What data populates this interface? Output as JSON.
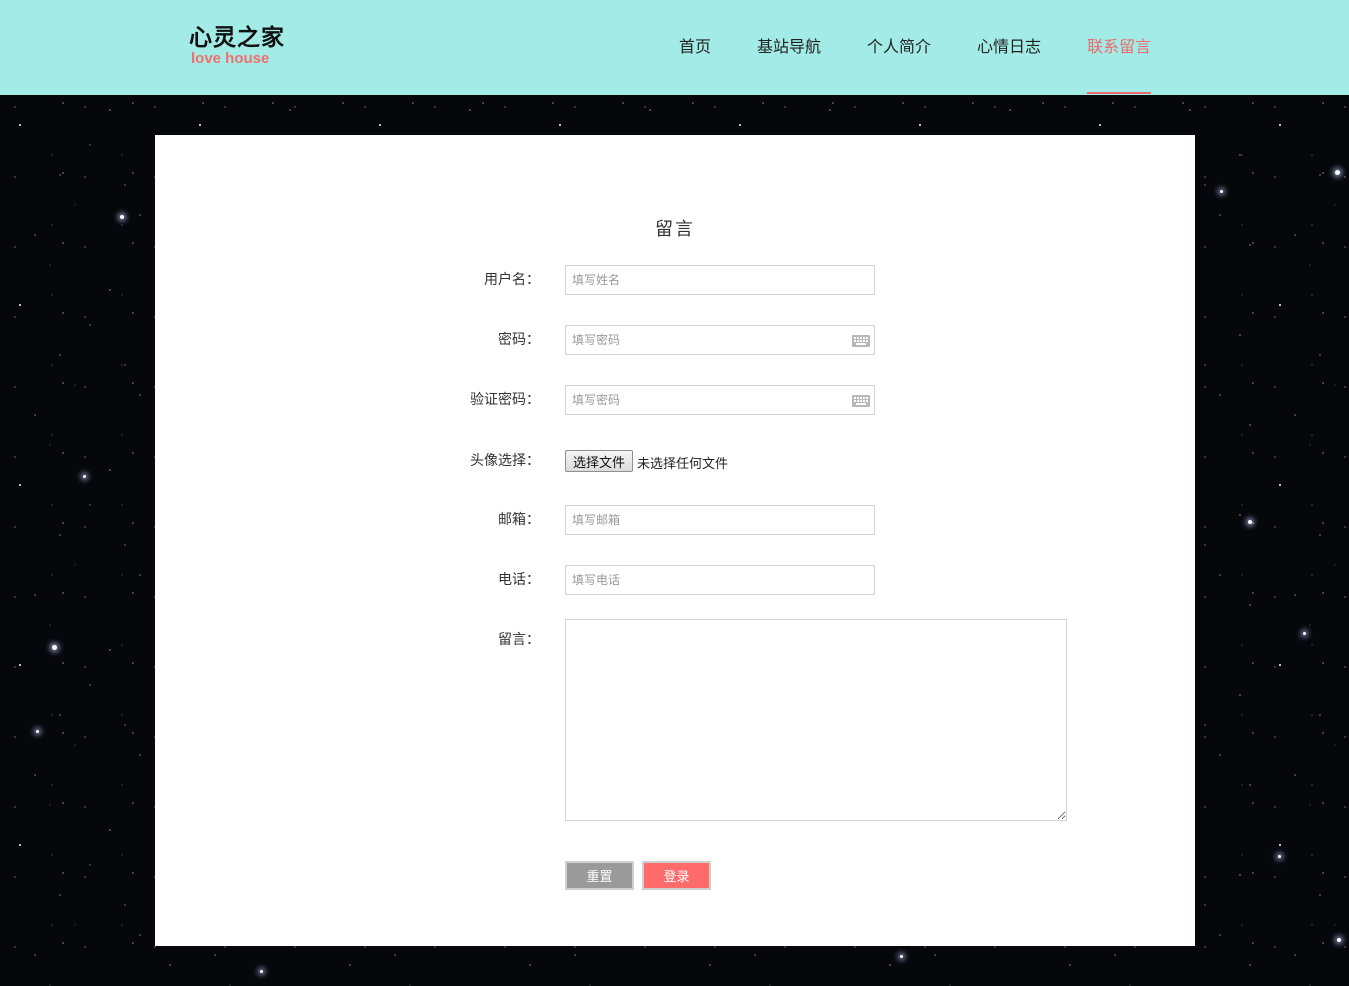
{
  "header": {
    "logo_cn": "心灵之家",
    "logo_en": "love house",
    "nav": [
      {
        "label": "首页",
        "active": false
      },
      {
        "label": "基站导航",
        "active": false
      },
      {
        "label": "个人简介",
        "active": false
      },
      {
        "label": "心情日志",
        "active": false
      },
      {
        "label": "联系留言",
        "active": true
      }
    ]
  },
  "form": {
    "title": "留言",
    "username": {
      "label": "用户名：",
      "placeholder": "填写姓名"
    },
    "password": {
      "label": "密码：",
      "placeholder": "填写密码"
    },
    "confirm_password": {
      "label": "验证密码：",
      "placeholder": "填写密码"
    },
    "avatar": {
      "label": "头像选择：",
      "button": "选择文件",
      "status": "未选择任何文件"
    },
    "email": {
      "label": "邮箱：",
      "placeholder": "填写邮箱"
    },
    "phone": {
      "label": "电话：",
      "placeholder": "填写电话"
    },
    "message": {
      "label": "留言："
    },
    "reset_label": "重置",
    "submit_label": "登录"
  },
  "colors": {
    "header_bg": "#a2ebe6",
    "accent": "#ee6b6b",
    "reset_button": "#9a9a9a",
    "submit_button": "#ff6a6a"
  },
  "icons": {
    "password_field": "keyboard-icon",
    "confirm_password_field": "keyboard-icon"
  }
}
